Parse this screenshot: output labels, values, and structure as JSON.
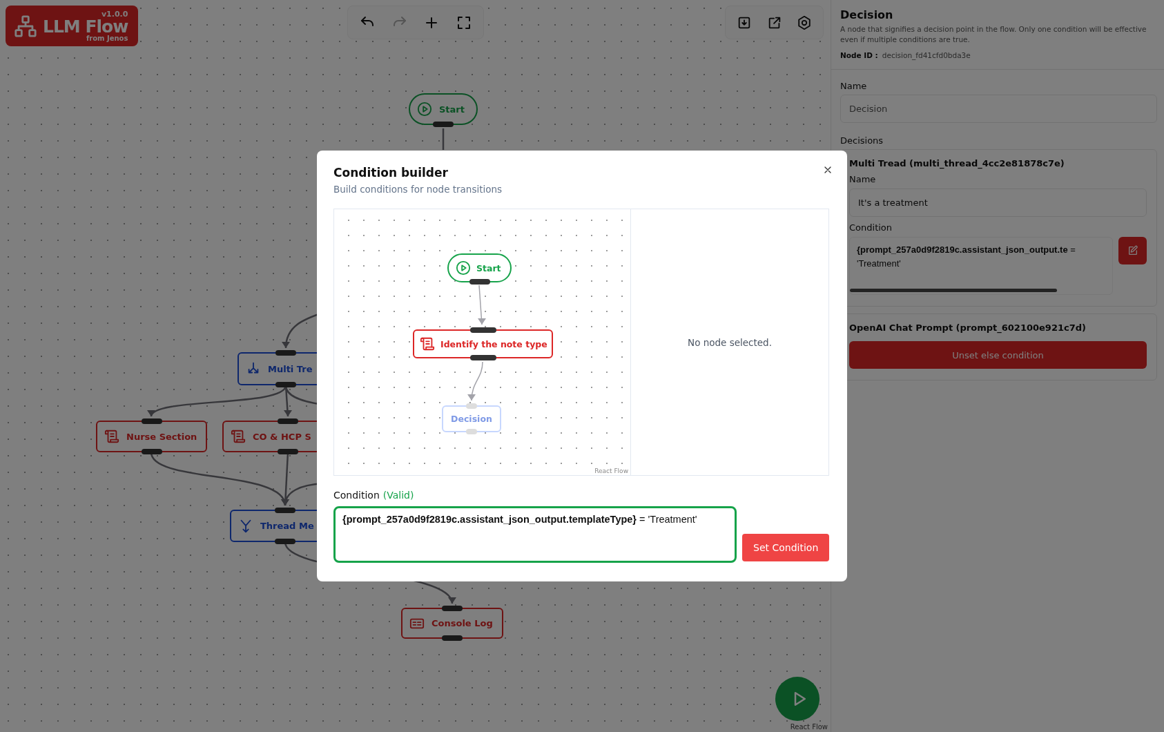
{
  "logo": {
    "name": "LLM Flow",
    "version": "v1.0.0",
    "byline": "from Jenos"
  },
  "toolbar": [
    {
      "kind": "undo",
      "disabled": false
    },
    {
      "kind": "redo",
      "disabled": true
    },
    {
      "kind": "add",
      "disabled": false
    },
    {
      "kind": "fit",
      "disabled": false
    }
  ],
  "actions": [
    {
      "kind": "download"
    },
    {
      "kind": "export"
    },
    {
      "kind": "settings"
    }
  ],
  "canvas": {
    "nodes": [
      {
        "kind": "start",
        "label": "Start"
      },
      {
        "kind": "multi_thread",
        "label": "Multi Tre"
      },
      {
        "kind": "prompt",
        "label": "Nurse Section"
      },
      {
        "kind": "prompt",
        "label": "CO & HCP S"
      },
      {
        "kind": "merge",
        "label": "Thread Me"
      },
      {
        "kind": "log",
        "label": "Console Log"
      }
    ],
    "attribution": "React Flow"
  },
  "panel": {
    "title": "Decision",
    "description": "A node that signifies a decision point in the flow. Only one condition will be effective even if multiple conditions are true.",
    "node_id_label": "Node ID :",
    "node_id": "decision_fd41cfd0bda3e",
    "name_label": "Name",
    "name_placeholder": "Decision",
    "decisions_label": "Decisions",
    "decisions": [
      {
        "kind": "condition",
        "title": "Multi Tread (multi_thread_4cc2e81878c7e)",
        "name_label": "Name",
        "name_value": "It's a treatment",
        "condition_label": "Condition",
        "condition": "**{prompt_257a0d9f2819c.assistant_json_output.te** = 'Treatment'"
      },
      {
        "kind": "else",
        "title": "OpenAI Chat Prompt (prompt_602100e921c7d)",
        "button": "Unset else condition"
      }
    ]
  },
  "modal": {
    "title": "Condition builder",
    "subtitle": "Build conditions for node transitions",
    "preview_nodes": [
      {
        "kind": "start",
        "label": "Start"
      },
      {
        "kind": "prompt",
        "label": "Identify the note type"
      },
      {
        "kind": "decision",
        "label": "Decision"
      }
    ],
    "attribution": "React Flow",
    "empty_text": "No node selected.",
    "condition_label": "Condition",
    "validity": "(Valid)",
    "valid": true,
    "condition": "**{prompt_257a0d9f2819c.assistant_json_output.templateType}** = 'Treatment'",
    "button": "Set Condition"
  }
}
